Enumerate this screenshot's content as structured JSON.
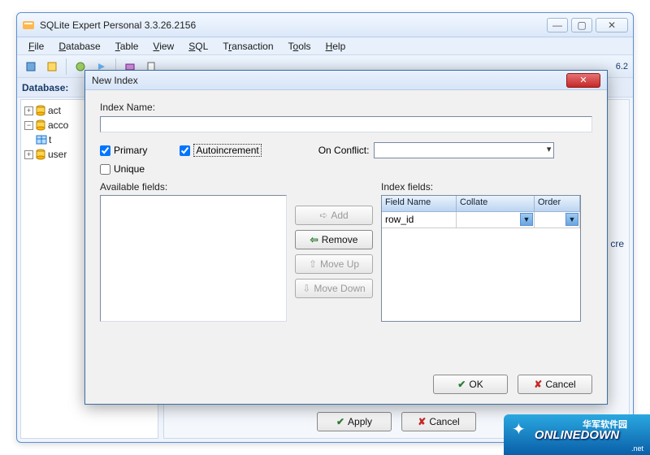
{
  "main_window": {
    "title": "SQLite Expert Personal 3.3.26.2156",
    "db_bar_label": "Database:",
    "version_tag": "6.2"
  },
  "menu": {
    "file": "File",
    "database": "Database",
    "table": "Table",
    "view": "View",
    "sql": "SQL",
    "transaction": "Transaction",
    "tools": "Tools",
    "help": "Help"
  },
  "tree": {
    "items": [
      {
        "label": "act",
        "toggle": "+"
      },
      {
        "label": "acco",
        "toggle": "−"
      },
      {
        "label": "t",
        "toggle": ""
      },
      {
        "label": "user",
        "toggle": "+"
      }
    ]
  },
  "right_panel": {
    "cre_label": "cre",
    "apply_label": "Apply",
    "cancel_label": "Cancel"
  },
  "dialog": {
    "title": "New Index",
    "index_name_label": "Index Name:",
    "index_name_value": "",
    "primary_label": "Primary",
    "primary_checked": true,
    "autoincrement_label": "Autoincrement",
    "autoincrement_checked": true,
    "unique_label": "Unique",
    "unique_checked": false,
    "on_conflict_label": "On Conflict:",
    "on_conflict_value": "",
    "available_label": "Available fields:",
    "index_fields_label": "Index fields:",
    "buttons": {
      "add": "Add",
      "remove": "Remove",
      "move_up": "Move Up",
      "move_down": "Move Down",
      "ok": "OK",
      "cancel": "Cancel"
    },
    "grid": {
      "headers": {
        "field_name": "Field Name",
        "collate": "Collate",
        "order": "Order"
      },
      "rows": [
        {
          "field_name": "row_id",
          "collate": "",
          "order": ""
        }
      ]
    }
  },
  "icons": {
    "app": "app-icon",
    "plus": "+",
    "minus": "−"
  },
  "watermark": {
    "cn": "华军软件园",
    "en": "ONLINEDOWN",
    "suffix": ".net"
  }
}
